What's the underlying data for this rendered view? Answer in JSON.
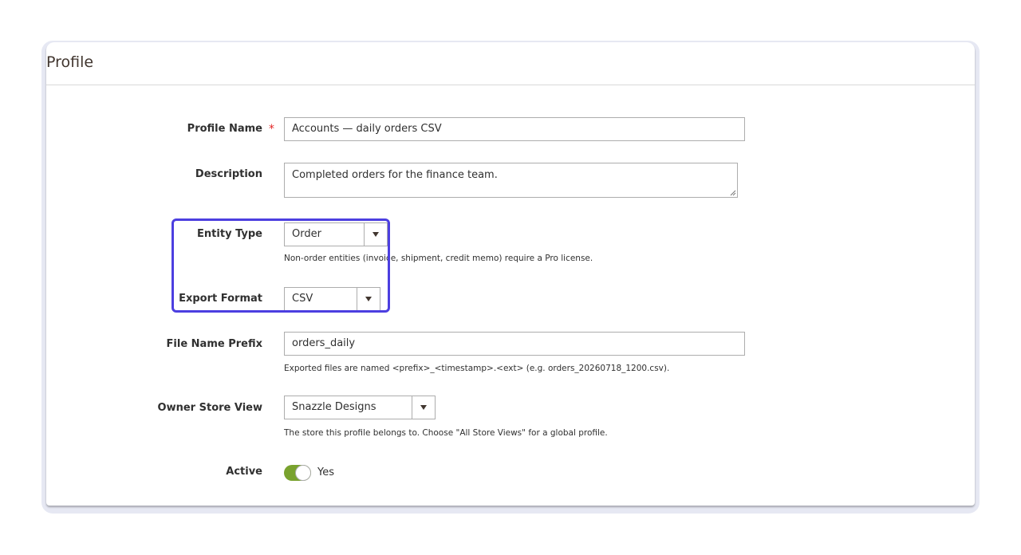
{
  "panel": {
    "title": "Profile"
  },
  "form": {
    "profile_name": {
      "label": "Profile Name",
      "required_mark": "*",
      "value": "Accounts — daily orders CSV"
    },
    "description": {
      "label": "Description",
      "value": "Completed orders for the finance team."
    },
    "entity_type": {
      "label": "Entity Type",
      "value": "Order",
      "note": "Non-order entities (invoice, shipment, credit memo) require a Pro license."
    },
    "export_format": {
      "label": "Export Format",
      "value": "CSV"
    },
    "file_name_prefix": {
      "label": "File Name Prefix",
      "value": "orders_daily",
      "note": "Exported files are named <prefix>_<timestamp>.<ext> (e.g. orders_20260718_1200.csv)."
    },
    "owner_store_view": {
      "label": "Owner Store View",
      "value": "Snazzle Designs",
      "note": "The store this profile belongs to. Choose \"All Store Views\" for a global profile."
    },
    "active": {
      "label": "Active",
      "value": "Yes",
      "enabled": true
    }
  },
  "colors": {
    "accent_highlight": "#4c3fe0",
    "toggle_on": "#79a22e",
    "required": "#e22626"
  },
  "icons": {
    "select_arrow": "chevron-down-icon"
  }
}
